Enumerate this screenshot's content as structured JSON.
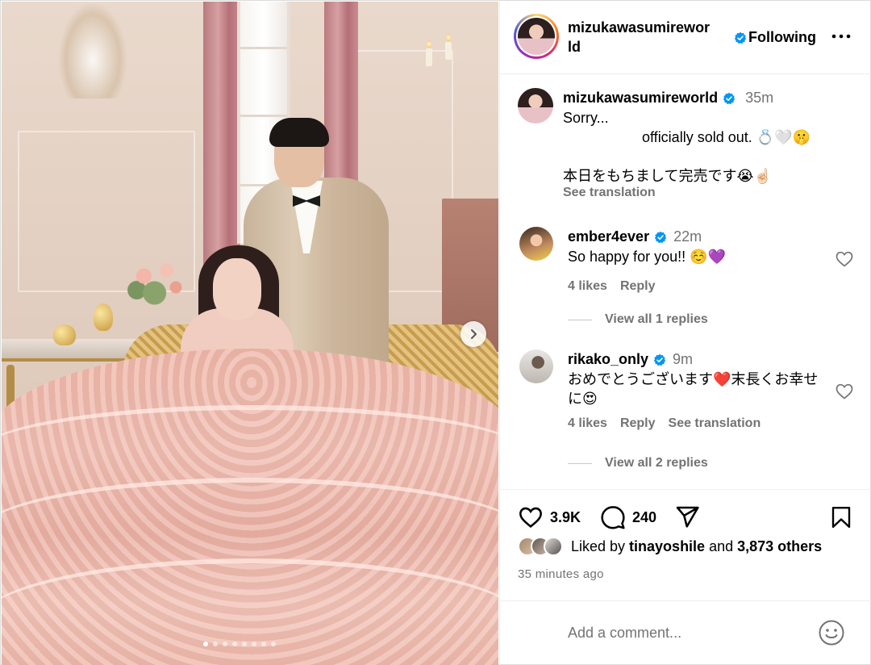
{
  "post": {
    "image_alt_icon": "wedding-photo",
    "carousel_dots": 8,
    "carousel_active": 0
  },
  "header": {
    "username": "mizukawasumireworld",
    "follow_label": "Following",
    "more_icon": "more-horizontal-icon",
    "verified_color": "#0095f6"
  },
  "caption": {
    "username": "mizukawasumireworld",
    "time": "35m",
    "line1": "Sorry...",
    "line2": "officially sold out. 💍🤍🤫",
    "line3": "本日をもちまして完売です😭☝🏻",
    "see_translation": "See translation"
  },
  "comments": [
    {
      "username": "ember4ever",
      "time": "22m",
      "text": "So happy for you!! ☺️💜",
      "likes": "4 likes",
      "reply": "Reply",
      "see_translation": "",
      "view_replies": "View all 1 replies"
    },
    {
      "username": "rikako_only",
      "time": "9m",
      "text": "おめでとうございます❤️末長くお幸せに😍",
      "likes": "4 likes",
      "reply": "Reply",
      "see_translation": "See translation",
      "view_replies": "View all 2 replies"
    }
  ],
  "actions": {
    "like_count": "3.9K",
    "comment_count": "240",
    "liked_by_prefix": "Liked by ",
    "liked_by_user": "tinayoshile",
    "liked_by_mid": " and ",
    "liked_by_others": "3,873 others",
    "timestamp": "35 minutes ago"
  },
  "composer": {
    "placeholder": "Add a comment..."
  }
}
